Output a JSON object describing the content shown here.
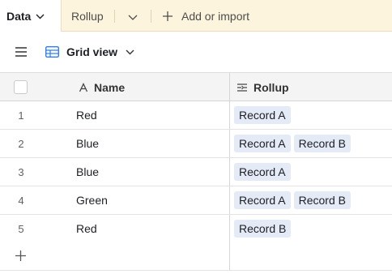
{
  "tabs": {
    "active": "Data",
    "rollup": "Rollup",
    "add_or_import": "Add or import"
  },
  "view": {
    "name": "Grid view"
  },
  "table": {
    "columns": [
      {
        "label": "Name",
        "icon": "text-field-icon"
      },
      {
        "label": "Rollup",
        "icon": "rollup-field-icon"
      }
    ],
    "rows": [
      {
        "num": "1",
        "name": "Red",
        "rollup": [
          "Record A"
        ]
      },
      {
        "num": "2",
        "name": "Blue",
        "rollup": [
          "Record A",
          "Record B"
        ]
      },
      {
        "num": "3",
        "name": "Blue",
        "rollup": [
          "Record A"
        ]
      },
      {
        "num": "4",
        "name": "Green",
        "rollup": [
          "Record A",
          "Record B"
        ]
      },
      {
        "num": "5",
        "name": "Red",
        "rollup": [
          "Record B"
        ]
      }
    ]
  },
  "colors": {
    "tabbar_bg": "#fcf4dc",
    "chip_bg": "#e4eaf6",
    "grid_icon": "#2d7ff9"
  }
}
